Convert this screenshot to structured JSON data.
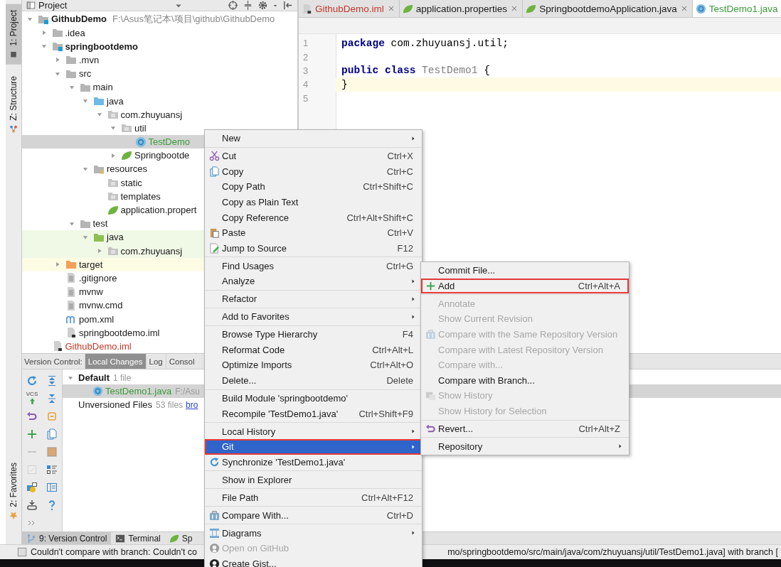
{
  "left_strip": {
    "top": [
      {
        "label": "1: Project",
        "kind": "project",
        "selected": true
      },
      {
        "label": "Z: Structure",
        "kind": "structure",
        "selected": false
      }
    ],
    "bottom": [
      {
        "label": "2: Favorites",
        "kind": "favorites",
        "selected": false
      }
    ]
  },
  "project_panel": {
    "title": "Project",
    "tree": [
      {
        "label": "GithubDemo",
        "path": "F:\\Asus笔记本\\项目\\github\\GithubDemo",
        "kind": "module",
        "bold": true,
        "expanded": true,
        "selected": false,
        "children": [
          {
            "label": ".idea",
            "kind": "folder",
            "expanded": false,
            "selected": false
          },
          {
            "label": "springbootdemo",
            "kind": "module",
            "bold": true,
            "expanded": true,
            "selected": false,
            "children": [
              {
                "label": ".mvn",
                "kind": "folder",
                "expanded": false,
                "selected": false
              },
              {
                "label": "src",
                "kind": "folder",
                "expanded": true,
                "selected": false,
                "children": [
                  {
                    "label": "main",
                    "kind": "folder",
                    "expanded": true,
                    "selected": false,
                    "children": [
                      {
                        "label": "java",
                        "kind": "source",
                        "expanded": true,
                        "selected": false,
                        "children": [
                          {
                            "label": "com.zhuyuansj",
                            "kind": "package",
                            "expanded": true,
                            "selected": false,
                            "children": [
                              {
                                "label": "util",
                                "kind": "package",
                                "expanded": true,
                                "selected": false,
                                "children": [
                                  {
                                    "label": "TestDemo",
                                    "kind": "class",
                                    "color": "#3a9a3a",
                                    "selected": true
                                  }
                                ]
                              },
                              {
                                "label": "Springbootde",
                                "kind": "spring",
                                "expanded": false,
                                "selected": false
                              }
                            ]
                          }
                        ]
                      },
                      {
                        "label": "resources",
                        "kind": "resources",
                        "expanded": true,
                        "selected": false,
                        "children": [
                          {
                            "label": "static",
                            "kind": "package",
                            "selected": false
                          },
                          {
                            "label": "templates",
                            "kind": "package",
                            "selected": false
                          },
                          {
                            "label": "application.propert",
                            "kind": "spring",
                            "selected": false
                          }
                        ]
                      }
                    ]
                  },
                  {
                    "label": "test",
                    "kind": "folder",
                    "expanded": true,
                    "selected": false,
                    "children": [
                      {
                        "label": "java",
                        "kind": "test",
                        "expanded": true,
                        "selected": false,
                        "children": [
                          {
                            "label": "com.zhuyuansj",
                            "kind": "test-package",
                            "expanded": false,
                            "selected": false
                          }
                        ]
                      }
                    ]
                  }
                ]
              },
              {
                "label": "target",
                "kind": "excluded",
                "expanded": false,
                "selected": false
              },
              {
                "label": ".gitignore",
                "kind": "file",
                "selected": false
              },
              {
                "label": "mvnw",
                "kind": "file",
                "selected": false
              },
              {
                "label": "mvnw.cmd",
                "kind": "file",
                "selected": false
              },
              {
                "label": "pom.xml",
                "kind": "maven",
                "selected": false
              },
              {
                "label": "springbootdemo.iml",
                "kind": "iml",
                "selected": false
              }
            ]
          },
          {
            "label": "GithubDemo.iml",
            "kind": "iml",
            "color": "#c0392b",
            "selected": false
          }
        ]
      }
    ]
  },
  "editor": {
    "tabs": [
      {
        "label": "GithubDemo.iml",
        "kind": "iml",
        "color": "#c0392b",
        "closable": true,
        "selected": false
      },
      {
        "label": "application.properties",
        "kind": "spring",
        "closable": true,
        "selected": false
      },
      {
        "label": "SpringbootdemoApplication.java",
        "kind": "spring",
        "closable": true,
        "selected": false
      },
      {
        "label": "TestDemo1.java",
        "kind": "class",
        "color": "#3a9a3a",
        "closable": false,
        "selected": true
      }
    ],
    "lines": [
      {
        "number": "1",
        "current": false,
        "tokens": [
          {
            "text": "package",
            "kind": "keyword"
          },
          {
            "text": " com.zhuyuansj.util;",
            "kind": "plain"
          }
        ]
      },
      {
        "number": "2",
        "current": false
      },
      {
        "number": "3",
        "current": false,
        "tokens": [
          {
            "text": "public class",
            "kind": "keyword"
          },
          {
            "text": " TestDemo1",
            "kind": "unused"
          },
          {
            "text": " {",
            "kind": "plain"
          }
        ]
      },
      {
        "number": "4",
        "current": true,
        "tokens": [
          {
            "text": "}",
            "kind": "plain"
          }
        ]
      },
      {
        "number": "5",
        "current": false
      }
    ]
  },
  "version_control": {
    "label": "Version Control:",
    "tabs": [
      {
        "label": "Local Changes",
        "selected": true
      },
      {
        "label": "Log",
        "selected": false
      },
      {
        "label": "Consol",
        "selected": false
      }
    ],
    "tools": [
      {
        "kind": "refresh",
        "disabled": false
      },
      {
        "kind": "expand",
        "disabled": false
      },
      {
        "kind": "commit",
        "label": "VCS",
        "disabled": false
      },
      {
        "kind": "collapse",
        "disabled": false
      },
      {
        "kind": "revert",
        "disabled": false
      },
      {
        "kind": "shelve",
        "disabled": false
      },
      {
        "kind": "plus",
        "disabled": false
      },
      {
        "kind": "copy",
        "disabled": false
      },
      {
        "kind": "minus",
        "disabled": true
      },
      {
        "kind": "square",
        "disabled": false
      },
      {
        "kind": "checkbox",
        "disabled": true
      },
      {
        "kind": "group",
        "disabled": false
      },
      {
        "kind": "diff",
        "disabled": false
      },
      {
        "kind": "layout",
        "disabled": false
      },
      {
        "kind": "download",
        "disabled": false
      },
      {
        "kind": "help",
        "disabled": false
      },
      {
        "kind": "more",
        "disabled": false
      }
    ],
    "changes": [
      {
        "label": "Default",
        "kind": "changelist",
        "count": "1 file",
        "expanded": true,
        "selected": false,
        "children": [
          {
            "label": "TestDemo1.java",
            "kind": "file",
            "color": "#3a9a3a",
            "path": "F:/Asu",
            "selected": true
          }
        ]
      },
      {
        "label": "Unversioned Files",
        "kind": "unversioned",
        "count": "53 files",
        "link": "bro",
        "selected": false
      }
    ]
  },
  "bottom_tabs": [
    {
      "label": "9: Version Control",
      "kind": "branch",
      "selected": true
    },
    {
      "label": "Terminal",
      "kind": "terminal",
      "selected": false
    },
    {
      "label": "Sp",
      "kind": "spring",
      "selected": false
    }
  ],
  "status_bar": {
    "message": "Couldn't compare with branch: Couldn't co",
    "message_end": "mo/springbootdemo/src/main/java/com/zhuyuansj/util/TestDemo1.java] with branch ["
  },
  "context_menu": [
    {
      "kind": "plain",
      "label": "New",
      "submenu": true,
      "selected": false,
      "disabled": false,
      "outlined": false
    },
    {
      "kind": "separator"
    },
    {
      "kind": "cut",
      "label": "Cut",
      "shortcut": "Ctrl+X",
      "submenu": false,
      "selected": false,
      "disabled": false,
      "outlined": false
    },
    {
      "kind": "copy",
      "label": "Copy",
      "shortcut": "Ctrl+C",
      "submenu": false,
      "selected": false,
      "disabled": false,
      "outlined": false
    },
    {
      "kind": "plain",
      "label": "Copy Path",
      "shortcut": "Ctrl+Shift+C",
      "submenu": false,
      "selected": false,
      "disabled": false,
      "outlined": false
    },
    {
      "kind": "plain",
      "label": "Copy as Plain Text",
      "submenu": false,
      "selected": false,
      "disabled": false,
      "outlined": false
    },
    {
      "kind": "plain",
      "label": "Copy Reference",
      "shortcut": "Ctrl+Alt+Shift+C",
      "submenu": false,
      "selected": false,
      "disabled": false,
      "outlined": false
    },
    {
      "kind": "paste",
      "label": "Paste",
      "shortcut": "Ctrl+V",
      "submenu": false,
      "selected": false,
      "disabled": false,
      "outlined": false
    },
    {
      "kind": "jump",
      "label": "Jump to Source",
      "shortcut": "F12",
      "submenu": false,
      "selected": false,
      "disabled": false,
      "outlined": false
    },
    {
      "kind": "separator"
    },
    {
      "kind": "plain",
      "label": "Find Usages",
      "shortcut": "Ctrl+G",
      "submenu": false,
      "selected": false,
      "disabled": false,
      "outlined": false
    },
    {
      "kind": "plain",
      "label": "Analyze",
      "submenu": true,
      "selected": false,
      "disabled": false,
      "outlined": false
    },
    {
      "kind": "separator"
    },
    {
      "kind": "plain",
      "label": "Refactor",
      "submenu": true,
      "selected": false,
      "disabled": false,
      "outlined": false
    },
    {
      "kind": "separator"
    },
    {
      "kind": "plain",
      "label": "Add to Favorites",
      "submenu": true,
      "selected": false,
      "disabled": false,
      "outlined": false
    },
    {
      "kind": "separator"
    },
    {
      "kind": "plain",
      "label": "Browse Type Hierarchy",
      "shortcut": "F4",
      "submenu": false,
      "selected": false,
      "disabled": false,
      "outlined": false
    },
    {
      "kind": "plain",
      "label": "Reformat Code",
      "shortcut": "Ctrl+Alt+L",
      "submenu": false,
      "selected": false,
      "disabled": false,
      "outlined": false
    },
    {
      "kind": "plain",
      "label": "Optimize Imports",
      "shortcut": "Ctrl+Alt+O",
      "submenu": false,
      "selected": false,
      "disabled": false,
      "outlined": false
    },
    {
      "kind": "plain",
      "label": "Delete...",
      "shortcut": "Delete",
      "submenu": false,
      "selected": false,
      "disabled": false,
      "outlined": false
    },
    {
      "kind": "separator"
    },
    {
      "kind": "plain",
      "label": "Build Module 'springbootdemo'",
      "submenu": false,
      "selected": false,
      "disabled": false,
      "outlined": false
    },
    {
      "kind": "plain",
      "label": "Recompile 'TestDemo1.java'",
      "shortcut": "Ctrl+Shift+F9",
      "submenu": false,
      "selected": false,
      "disabled": false,
      "outlined": false
    },
    {
      "kind": "separator"
    },
    {
      "kind": "plain",
      "label": "Local History",
      "submenu": true,
      "selected": false,
      "disabled": false,
      "outlined": false
    },
    {
      "kind": "plain",
      "label": "Git",
      "submenu": true,
      "selected": true,
      "disabled": false,
      "outlined": true
    },
    {
      "kind": "sync",
      "label": "Synchronize 'TestDemo1.java'",
      "submenu": false,
      "selected": false,
      "disabled": false,
      "outlined": false
    },
    {
      "kind": "separator"
    },
    {
      "kind": "plain",
      "label": "Show in Explorer",
      "submenu": false,
      "selected": false,
      "disabled": false,
      "outlined": false
    },
    {
      "kind": "separator"
    },
    {
      "kind": "plain",
      "label": "File Path",
      "shortcut": "Ctrl+Alt+F12",
      "submenu": false,
      "selected": false,
      "disabled": false,
      "outlined": false
    },
    {
      "kind": "separator"
    },
    {
      "kind": "compare",
      "label": "Compare With...",
      "shortcut": "Ctrl+D",
      "submenu": false,
      "selected": false,
      "disabled": false,
      "outlined": false
    },
    {
      "kind": "separator"
    },
    {
      "kind": "diagrams",
      "label": "Diagrams",
      "submenu": true,
      "selected": false,
      "disabled": false,
      "outlined": false
    },
    {
      "kind": "github",
      "label": "Open on GitHub",
      "submenu": false,
      "selected": false,
      "disabled": true,
      "outlined": false
    },
    {
      "kind": "github",
      "label": "Create Gist...",
      "submenu": false,
      "selected": false,
      "disabled": false,
      "outlined": false
    }
  ],
  "git_submenu": [
    {
      "kind": "plain",
      "label": "Commit File...",
      "submenu": false,
      "selected": false,
      "disabled": false,
      "outlined": false
    },
    {
      "kind": "plus",
      "label": "Add",
      "shortcut": "Ctrl+Alt+A",
      "submenu": false,
      "selected": false,
      "disabled": false,
      "outlined": true
    },
    {
      "kind": "separator"
    },
    {
      "kind": "plain",
      "label": "Annotate",
      "submenu": false,
      "selected": false,
      "disabled": true,
      "outlined": false
    },
    {
      "kind": "plain",
      "label": "Show Current Revision",
      "submenu": false,
      "selected": false,
      "disabled": true,
      "outlined": false
    },
    {
      "kind": "compare",
      "label": "Compare with the Same Repository Version",
      "submenu": false,
      "selected": false,
      "disabled": true,
      "outlined": false
    },
    {
      "kind": "plain",
      "label": "Compare with Latest Repository Version",
      "submenu": false,
      "selected": false,
      "disabled": true,
      "outlined": false
    },
    {
      "kind": "plain",
      "label": "Compare with...",
      "submenu": false,
      "selected": false,
      "disabled": true,
      "outlined": false
    },
    {
      "kind": "plain",
      "label": "Compare with Branch...",
      "submenu": false,
      "selected": false,
      "disabled": false,
      "outlined": false
    },
    {
      "kind": "history",
      "label": "Show History",
      "submenu": false,
      "selected": false,
      "disabled": true,
      "outlined": false
    },
    {
      "kind": "plain",
      "label": "Show History for Selection",
      "submenu": false,
      "selected": false,
      "disabled": true,
      "outlined": false
    },
    {
      "kind": "separator"
    },
    {
      "kind": "revert",
      "label": "Revert...",
      "shortcut": "Ctrl+Alt+Z",
      "submenu": false,
      "selected": false,
      "disabled": false,
      "outlined": false
    },
    {
      "kind": "separator"
    },
    {
      "kind": "plain",
      "label": "Repository",
      "submenu": true,
      "selected": false,
      "disabled": false,
      "outlined": false
    }
  ]
}
